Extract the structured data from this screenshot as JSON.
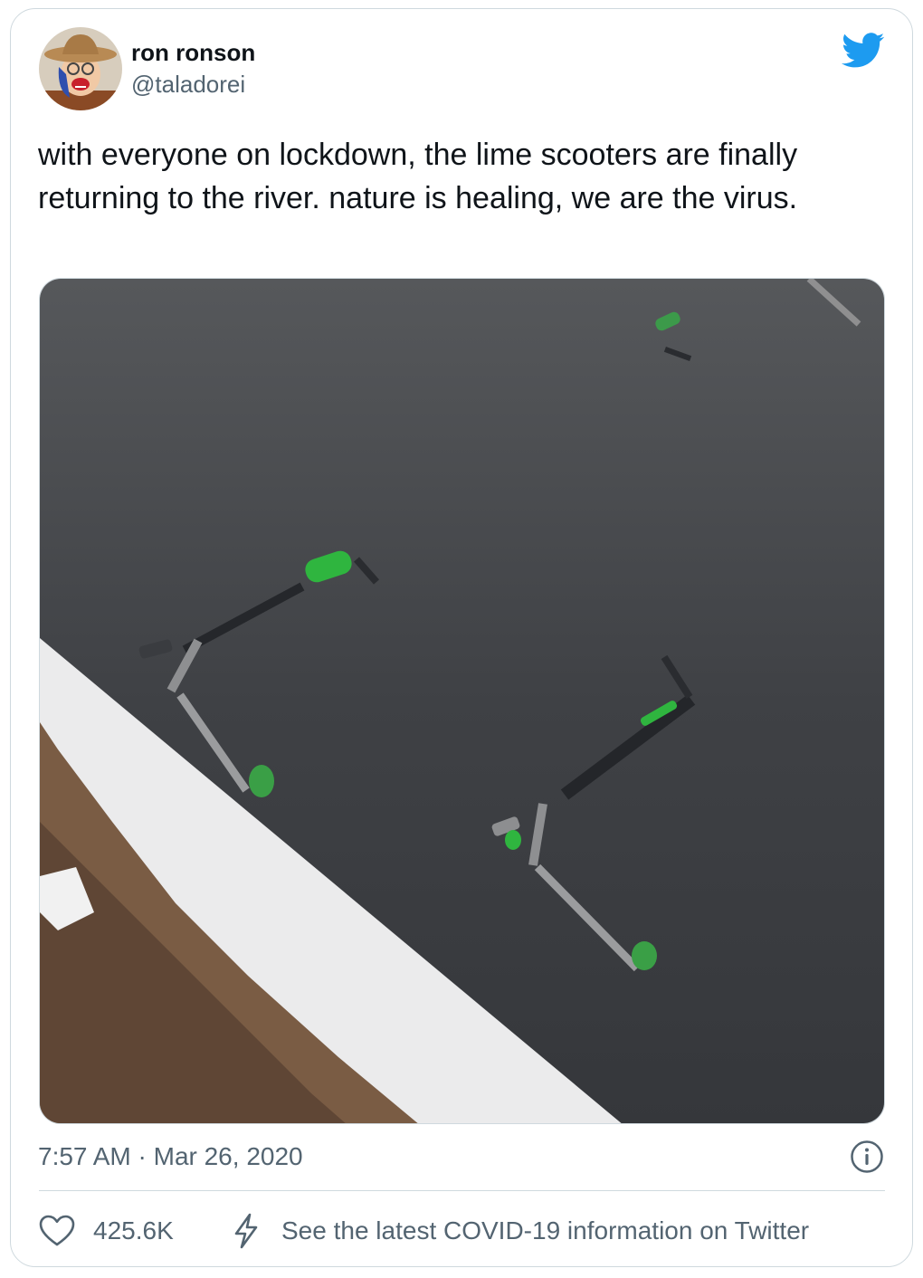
{
  "author": {
    "display_name": "ron ronson",
    "handle": "@taladorei"
  },
  "tweet": {
    "text": "with everyone on lockdown, the lime scooters are finally returning to the river. nature is healing, we are the virus.",
    "timestamp": "7:57 AM · Mar 26, 2020"
  },
  "actions": {
    "like_count": "425.6K",
    "covid_info_label": "See the latest COVID-19 information on Twitter"
  },
  "icons": {
    "brand": "twitter-bird-icon",
    "info": "info-icon",
    "like": "heart-icon",
    "covid": "lightning-bolt-icon"
  },
  "colors": {
    "twitter_blue": "#1d9bf0",
    "text_primary": "#0f1419",
    "text_secondary": "#536471",
    "border": "#cfd9de"
  }
}
